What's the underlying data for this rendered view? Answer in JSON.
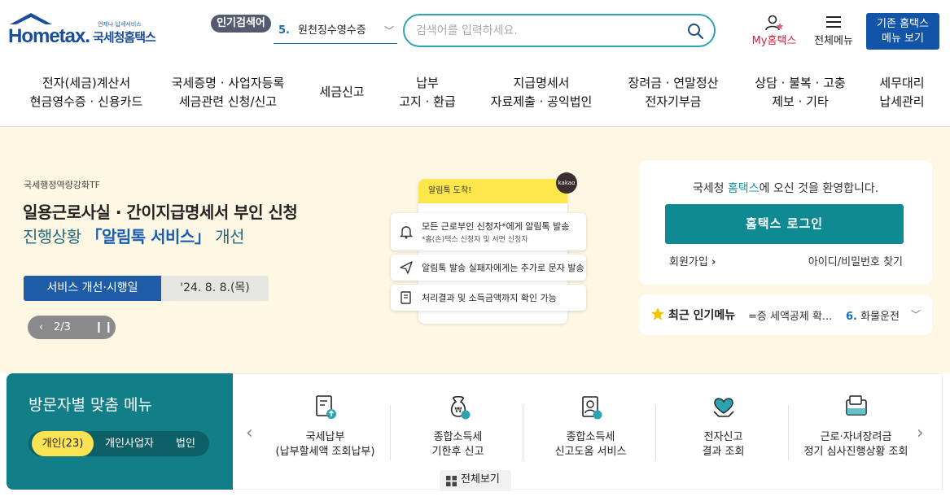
{
  "header": {
    "logo_word": "Hometax.",
    "logo_kor": "국세청홈택스",
    "logo_tiny": "언제나 납세서비스",
    "hot_badge": "인기검색어",
    "hot_num": "5.",
    "hot_term": "원천징수영수증",
    "search_placeholder": "검색어를 입력하세요.",
    "my_label": "My홈택스",
    "all_menu_label": "전체메뉴",
    "old_hometax_line1": "기존 홈택스",
    "old_hometax_line2": "메뉴 보기"
  },
  "gnb": [
    {
      "label": "전자(세금)계산서\n현금영수증 · 신용카드"
    },
    {
      "label": "국세증명 · 사업자등록\n세금관련 신청/신고"
    },
    {
      "label": "세금신고"
    },
    {
      "label": "납부\n고지 · 환급"
    },
    {
      "label": "지급명세서\n자료제출 · 공익법인"
    },
    {
      "label": "장려금 · 연말정산\n전자기부금"
    },
    {
      "label": "상담 · 불복 · 고충\n제보 · 기타"
    },
    {
      "label": "세무대리\n납세관리"
    }
  ],
  "hero": {
    "tag": "국세행정역량강화TF",
    "title": "일용근로사실 · 간이지급명세서 부인 신청",
    "sub_before": "진행상황 ",
    "sub_highlight": "「알림톡 서비스」",
    "sub_after": " 개선",
    "pill_label": "서비스 개선·시행일",
    "pill_date": "'24. 8. 8.(목)",
    "pager_text": "2/3",
    "card_head": "알림톡 도착!",
    "kakao": "kakao",
    "bubble1_line1": "모든 근로부인 신청자*에게 알림톡 발송",
    "bubble1_line2": "*홈(손)택스 신청자 및 서면 신청자",
    "bubble2": "알림톡 발송 실패자에게는 추가로 문자 발송",
    "bubble3": "처리결과 및 소득금액까지 확인 가능"
  },
  "login": {
    "welcome_before": "국세청 ",
    "welcome_brand": "홈택스",
    "welcome_after": "에 오신 것을 환영합니다.",
    "login_button": "홈택스 로그인",
    "join": "회원가입",
    "find": "아이디/비밀번호 찾기"
  },
  "popular": {
    "label": "최근 인기메뉴",
    "current": "=증 세액공제 확...",
    "next_num": "6.",
    "next_term": "화물운전"
  },
  "visitor": {
    "title": "방문자별 맞춤 메뉴",
    "tabs": [
      "개인(23)",
      "개인사업자",
      "법인"
    ]
  },
  "quick": [
    {
      "label": "국세납부\n(납부할세액 조회납부)",
      "icon": "tax-payment-icon"
    },
    {
      "label": "종합소득세\n기한후 신고",
      "icon": "income-tax-late-icon"
    },
    {
      "label": "종합소득세\n신고도움 서비스",
      "icon": "income-tax-help-icon"
    },
    {
      "label": "전자신고\n결과 조회",
      "icon": "e-filing-result-icon"
    },
    {
      "label": "근로·자녀장려금\n정기 심사진행상황 조회",
      "icon": "incentive-review-icon"
    }
  ],
  "view_all": "전체보기",
  "colors": {
    "brand_blue": "#1254a8",
    "teal": "#0f8a92",
    "hero_bg": "#fdf7e4",
    "yellow": "#fce353"
  }
}
